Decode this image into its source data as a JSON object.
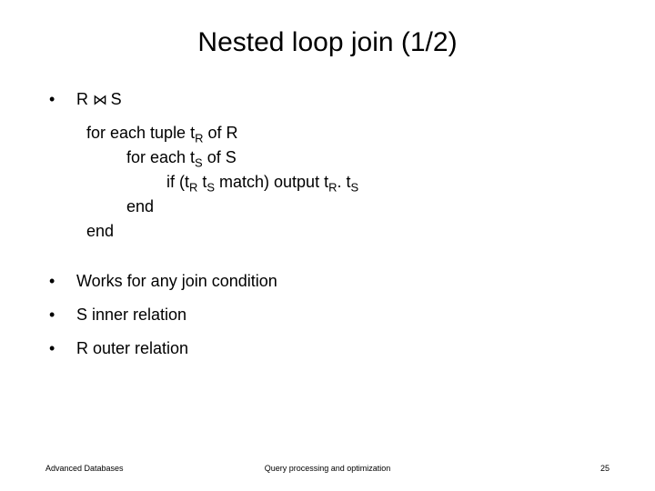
{
  "title": "Nested loop join (1/2)",
  "expr": {
    "lhs": "R",
    "op": "⋈",
    "rhs": "S"
  },
  "algo": {
    "line1_prefix": "for each tuple t",
    "line1_sub": "R",
    "line1_suffix": " of R",
    "line2_prefix": "for each t",
    "line2_sub": "S",
    "line2_suffix": " of S",
    "line3_prefix": "if (t",
    "line3_sub1": "R",
    "line3_mid1": " t",
    "line3_sub2": "S",
    "line3_mid2": " match) output t",
    "line3_sub3": "R",
    "line3_mid3": ". t",
    "line3_sub4": "S",
    "end": "end"
  },
  "bullets": [
    "Works for any join condition",
    "S inner relation",
    "R outer relation"
  ],
  "footer": {
    "left": "Advanced Databases",
    "center": "Query processing and optimization",
    "right": "25"
  },
  "bullet_mark": "•"
}
